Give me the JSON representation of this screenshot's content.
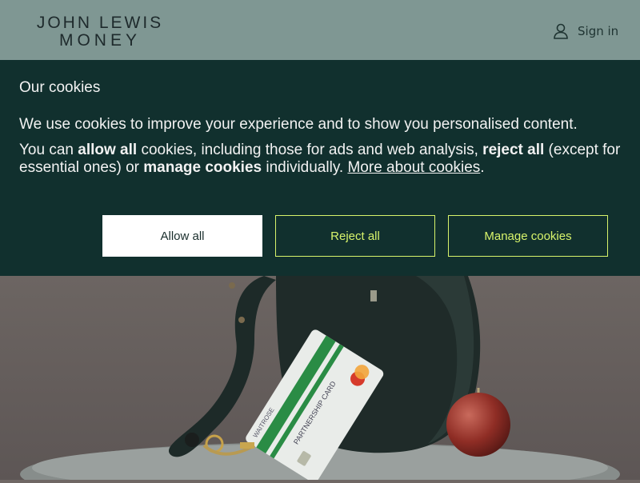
{
  "header": {
    "logo_line1": "JOHN LEWIS",
    "logo_line2": "MONEY",
    "signin_label": "Sign in"
  },
  "cookie_banner": {
    "title": "Our cookies",
    "intro": "We use cookies to improve your experience and to show you personalised content.",
    "text_part1": "You can ",
    "allow_all_bold": "allow all",
    "text_part2": " cookies, including those for ads and web analysis, ",
    "reject_all_bold": "reject all",
    "text_part3": " (except for essential ones) or ",
    "manage_bold": "manage cookies",
    "text_part4": " individually. ",
    "more_link": "More about cookies",
    "text_part5": ".",
    "buttons": {
      "allow": "Allow all",
      "reject": "Reject all",
      "manage": "Manage cookies"
    }
  },
  "hero": {
    "card_brand": "WAITROSE",
    "card_text": "PARTNERSHIP CARD"
  },
  "colors": {
    "header_bg": "#7f9793",
    "banner_bg": "#11302e",
    "accent": "#d7f36b"
  }
}
